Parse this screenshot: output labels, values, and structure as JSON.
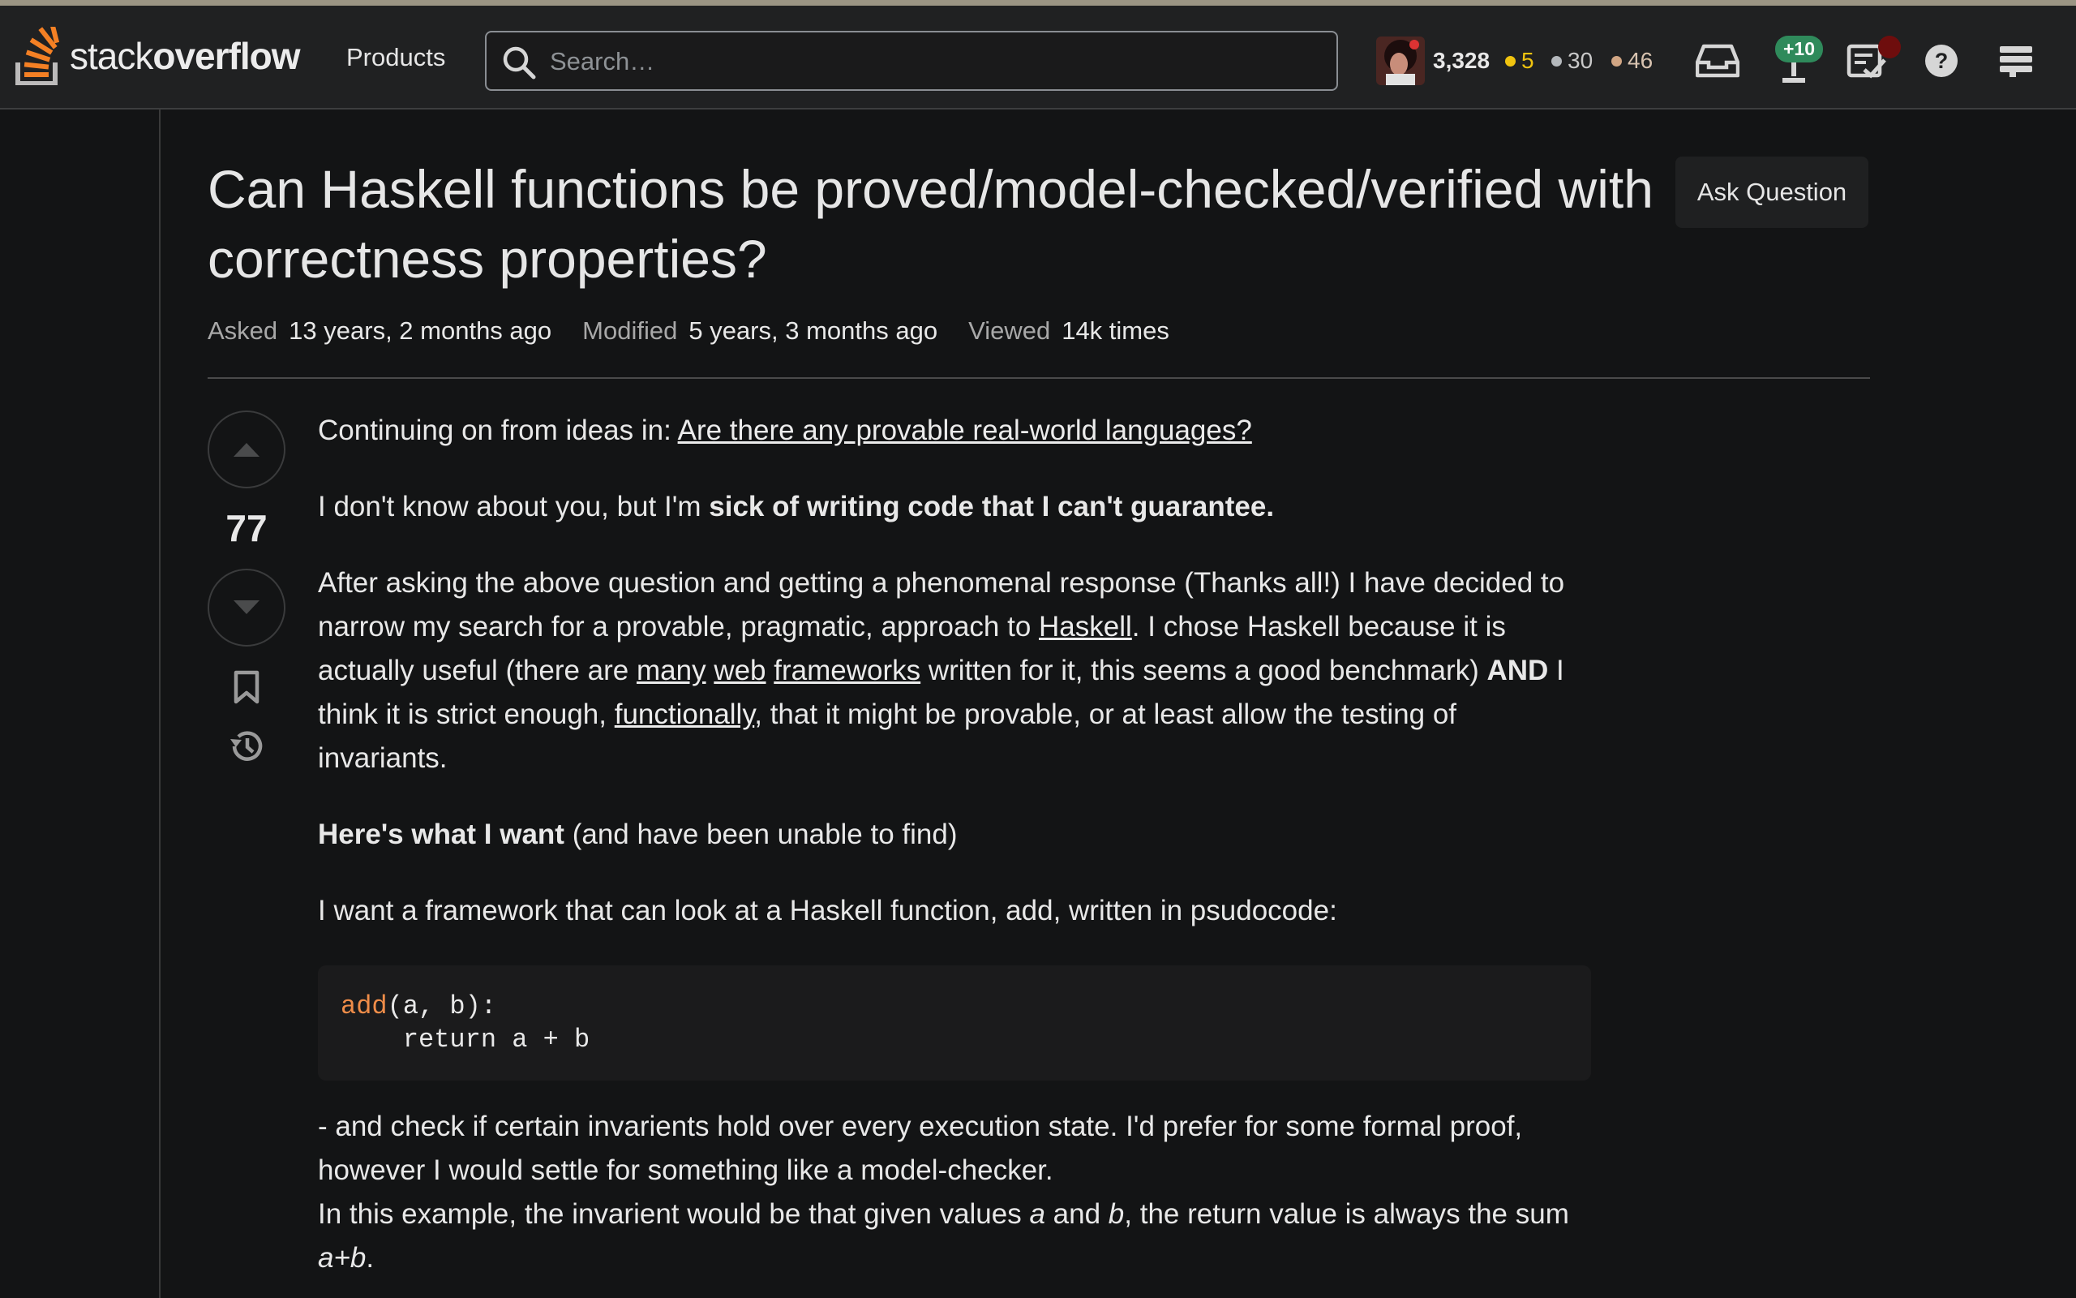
{
  "brand": {
    "logo_light": "stack",
    "logo_bold": "overflow"
  },
  "nav": {
    "products": "Products"
  },
  "search": {
    "placeholder": "Search…"
  },
  "user": {
    "reputation": "3,328",
    "gold": "5",
    "silver": "30",
    "bronze": "46",
    "achievements_delta": "+10"
  },
  "colors": {
    "gold": "#f1c40f",
    "silver": "#b4b8bc",
    "bronze": "#d1a684",
    "achievement": "#2f8a5b",
    "accent": "#f48024"
  },
  "icons": [
    "stackoverflow-logo",
    "search-icon",
    "inbox-icon",
    "achievements-icon",
    "review-queue-icon",
    "help-icon",
    "site-switcher-icon",
    "upvote-icon",
    "downvote-icon",
    "bookmark-icon",
    "history-icon"
  ],
  "question": {
    "title": "Can Haskell functions be proved/model-checked/verified with correctness properties?",
    "ask_button": "Ask Question",
    "asked_label": "Asked",
    "asked_value": "13 years, 2 months ago",
    "modified_label": "Modified",
    "modified_value": "5 years, 3 months ago",
    "viewed_label": "Viewed",
    "viewed_value": "14k times",
    "score": "77"
  },
  "body": {
    "p1_prefix": "Continuing on from ideas in: ",
    "p1_link": "Are there any provable real-world languages?",
    "p2_prefix": "I don't know about you, but I'm ",
    "p2_bold": "sick of writing code that I can't guarantee.",
    "p3_a": "After asking the above question and getting a phenomenal response (Thanks all!) I have decided to narrow my search for a provable, pragmatic, approach to ",
    "p3_link_haskell": "Haskell",
    "p3_b": ". I chose Haskell because it is actually useful (there are ",
    "p3_link_many": "many",
    "p3_link_web": "web",
    "p3_link_frameworks": "frameworks",
    "p3_c": " written for it, this seems a good benchmark) ",
    "p3_bold_and": "AND",
    "p3_d": " I think it is strict enough, ",
    "p3_link_functionally": "functionally",
    "p3_e": ", that it might be provable, or at least allow the testing of invariants.",
    "p4_bold": "Here's what I want",
    "p4_rest": " (and have been unable to find)",
    "p5": "I want a framework that can look at a Haskell function, add, written in psudocode:",
    "code_fn": "add",
    "code_line1_rest": "(a, b):",
    "code_line2": "    return a + b",
    "p6_line1": "- and check if certain invarients hold over every execution state. I'd prefer for some formal proof, however I would settle for something like a model-checker.",
    "p6_line2_a": "In this example, the invarient would be that given values ",
    "p6_a": "a",
    "p6_and": " and ",
    "p6_b": "b",
    "p6_line2_c": ", the return value is always the sum ",
    "p6_sum": "a+b",
    "p6_end": "."
  }
}
